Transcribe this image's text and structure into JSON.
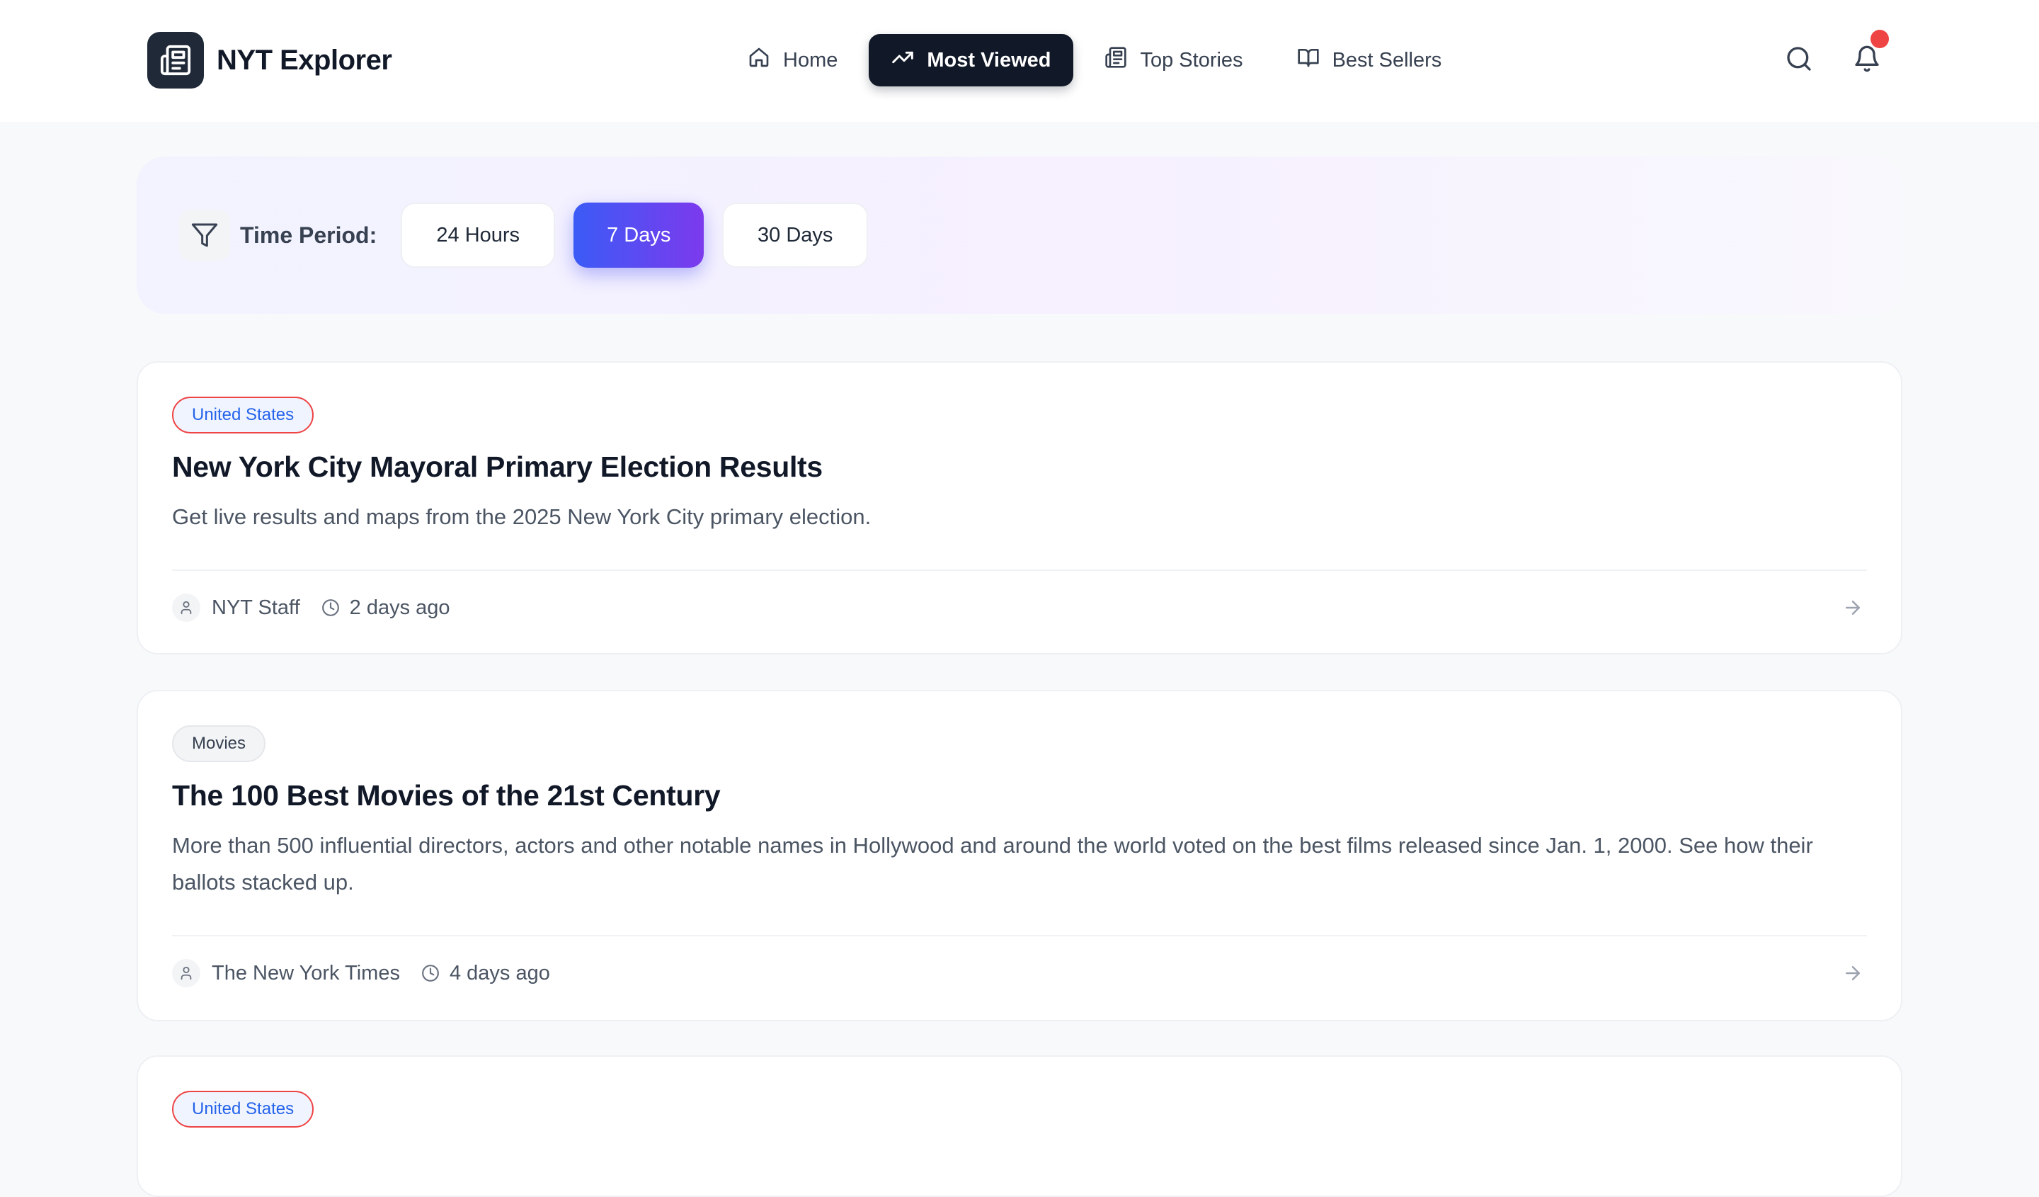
{
  "app": {
    "title": "NYT Explorer"
  },
  "nav": {
    "items": [
      {
        "label": "Home",
        "icon": "home-icon"
      },
      {
        "label": "Most Viewed",
        "icon": "trending-up-icon",
        "active": true
      },
      {
        "label": "Top Stories",
        "icon": "newspaper-icon"
      },
      {
        "label": "Best Sellers",
        "icon": "book-open-icon"
      }
    ]
  },
  "header": {
    "has_notification": true
  },
  "filter": {
    "label": "Time Period:",
    "options": [
      "24 Hours",
      "7 Days",
      "30 Days"
    ],
    "selected": "7 Days"
  },
  "articles": [
    {
      "section": "United States",
      "title": "New York City Mayoral Primary Election Results",
      "abstract": "Get live results and maps from the 2025 New York City primary election.",
      "byline": "NYT Staff",
      "time": "2 days ago"
    },
    {
      "section": "Movies",
      "title": "The 100 Best Movies of the 21st Century",
      "abstract": "More than 500 influential directors, actors and other notable names in Hollywood and around the world voted on the best films released since Jan. 1, 2000. See how their ballots stacked up.",
      "byline": "The New York Times",
      "time": "4 days ago"
    },
    {
      "section": "United States"
    }
  ],
  "colors": {
    "accent_start": "#3b5bf6",
    "accent_end": "#7c3aed",
    "nav_active": "#111827",
    "notification": "#ef4444",
    "tag_us_text": "#2563eb"
  }
}
